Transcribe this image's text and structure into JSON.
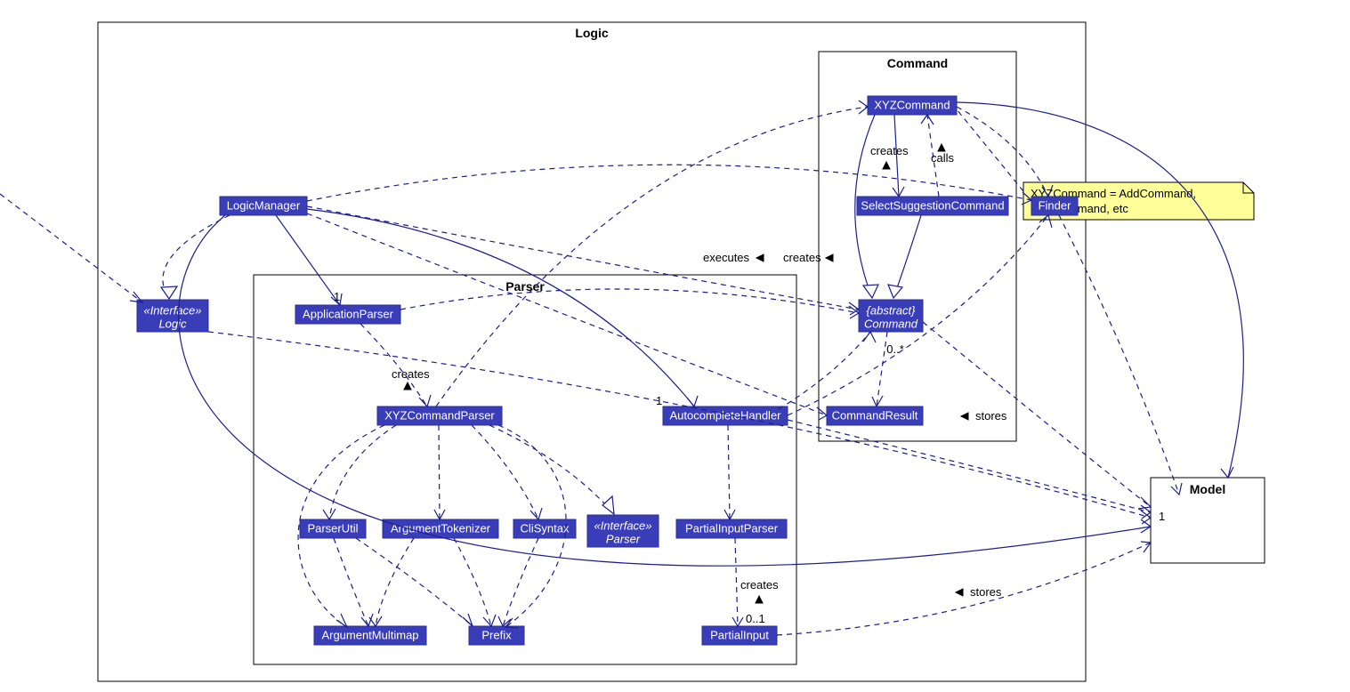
{
  "packages": {
    "logic": "Logic",
    "command": "Command",
    "parser": "Parser",
    "model": "Model"
  },
  "classes": {
    "logic_if": {
      "line1": "«Interface»",
      "line2": "Logic"
    },
    "logic_manager": "LogicManager",
    "app_parser": "ApplicationParser",
    "xyz_cmd_parser": "XYZCommandParser",
    "autocomplete": "AutocompleteHandler",
    "parser_util": "ParserUtil",
    "arg_tok": "ArgumentTokenizer",
    "cli_syntax": "CliSyntax",
    "parser_if": {
      "line1": "«Interface»",
      "line2": "Parser"
    },
    "partial_ip": "PartialInputParser",
    "arg_mm": "ArgumentMultimap",
    "prefix": "Prefix",
    "partial_in": "PartialInput",
    "xyz_cmd": "XYZCommand",
    "sel_sugg": "SelectSuggestionCommand",
    "abs_cmd": {
      "line1": "{abstract}",
      "line2": "Command"
    },
    "cmd_res": "CommandResult",
    "finder": "Finder"
  },
  "labels": {
    "creates1": "creates",
    "creates2": "creates",
    "creates3": "creates",
    "creates4": "creates",
    "calls": "calls",
    "executes": "executes",
    "stores1": "stores",
    "stores2": "stores",
    "one1": "1",
    "one2": "1",
    "one3": "1",
    "zero_star": "0..*",
    "zero_one": "0..1"
  },
  "note": {
    "line1": "XYZCommand = AddCommand,",
    "line2": "FindCommand, etc"
  },
  "colors": {
    "class_fill": "#3a3db8",
    "line": "#1b1e8e",
    "note_fill": "#ffff99"
  }
}
